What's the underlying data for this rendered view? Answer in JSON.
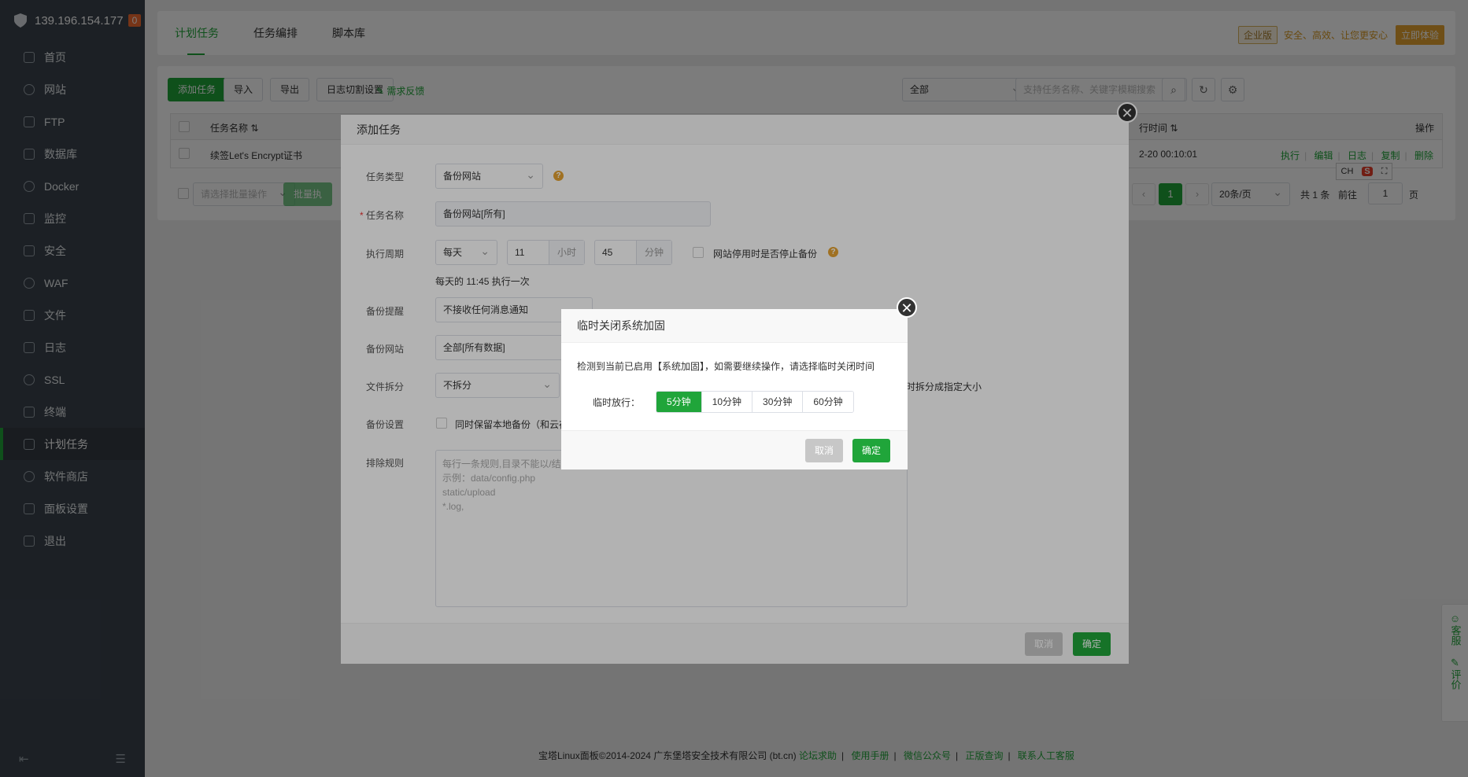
{
  "sidebar": {
    "server_ip": "139.196.154.177",
    "badge": "0",
    "items": [
      {
        "label": "首页",
        "icon": "home-icon"
      },
      {
        "label": "网站",
        "icon": "globe-icon"
      },
      {
        "label": "FTP",
        "icon": "ftp-icon"
      },
      {
        "label": "数据库",
        "icon": "database-icon"
      },
      {
        "label": "Docker",
        "icon": "docker-icon"
      },
      {
        "label": "监控",
        "icon": "monitor-icon"
      },
      {
        "label": "安全",
        "icon": "shield-icon"
      },
      {
        "label": "WAF",
        "icon": "waf-icon"
      },
      {
        "label": "文件",
        "icon": "folder-icon"
      },
      {
        "label": "日志",
        "icon": "log-icon"
      },
      {
        "label": "SSL",
        "icon": "ssl-icon"
      },
      {
        "label": "终端",
        "icon": "terminal-icon"
      },
      {
        "label": "计划任务",
        "icon": "calendar-icon",
        "active": true
      },
      {
        "label": "软件商店",
        "icon": "apps-icon"
      },
      {
        "label": "面板设置",
        "icon": "settings-icon"
      },
      {
        "label": "退出",
        "icon": "logout-icon"
      }
    ]
  },
  "tabs": [
    "计划任务",
    "任务编排",
    "脚本库"
  ],
  "promo": {
    "edition": "企业版",
    "slogan": "安全、高效、让您更安心",
    "try_label": "立即体验"
  },
  "toolbar": {
    "add_task": "添加任务",
    "import": "导入",
    "export": "导出",
    "log_split": "日志切割设置",
    "feedback": "需求反馈",
    "filter_value": "全部",
    "search_placeholder": "支持任务名称、关键字模糊搜索"
  },
  "table": {
    "headers": {
      "name": "任务名称",
      "time": "行时间",
      "ops": "操作"
    },
    "rows": [
      {
        "name": "续签Let's Encrypt证书",
        "time": "2-20 00:10:01",
        "ops": [
          "执行",
          "编辑",
          "日志",
          "复制",
          "删除"
        ]
      }
    ]
  },
  "batch": {
    "placeholder": "请选择批量操作",
    "button": "批量执"
  },
  "pager": {
    "current": "1",
    "page_size": "20条/页",
    "total": "共 1 条",
    "goto_label": "前往",
    "goto_value": "1",
    "page_unit": "页"
  },
  "modal_add": {
    "title": "添加任务",
    "task_type_label": "任务类型",
    "task_type": "备份网站",
    "task_name_label": "任务名称",
    "task_name": "备份网站[所有]",
    "period_label": "执行周期",
    "period": "每天",
    "hour": "11",
    "hour_unit": "小时",
    "minute": "45",
    "minute_unit": "分钟",
    "stop_backup_label": "网站停用时是否停止备份",
    "period_hint": "每天的 11:45 执行一次",
    "notify_label": "备份提醒",
    "notify": "不接收任何消息通知",
    "site_label": "备份网站",
    "site": "全部[所有数据]",
    "split_label": "文件拆分",
    "split": "不拆分",
    "split_hint": "时拆分成指定大小",
    "setting_label": "备份设置",
    "setting_text": "同时保留本地备份（和云存",
    "exclude_label": "排除规则",
    "exclude_placeholder": [
      "每行一条规则,目录不能以/结",
      "示例：data/config.php",
      "static/upload",
      "*.log,"
    ],
    "cancel": "取消",
    "confirm": "确定"
  },
  "modal_hardening": {
    "title": "临时关闭系统加固",
    "message": "检测到当前已启用【系统加固】，如需要继续操作，请选择临时关闭时间",
    "allow_label": "临时放行：",
    "options": [
      "5分钟",
      "10分钟",
      "30分钟",
      "60分钟"
    ],
    "selected": "5分钟",
    "cancel": "取消",
    "confirm": "确定"
  },
  "ime": {
    "lang": "CH",
    "logo": "S"
  },
  "float_panel": {
    "service": "客服",
    "review": "评价"
  },
  "footer": {
    "copyright": "宝塔Linux面板©2014-2024 广东堡塔安全技术有限公司 (bt.cn)",
    "links": [
      "论坛求助",
      "使用手册",
      "微信公众号",
      "正版查询",
      "联系人工客服"
    ]
  },
  "colors": {
    "accent": "#20a53a",
    "sidebar": "#3c444d",
    "badge": "#f26c32",
    "promo": "#e5a332"
  }
}
